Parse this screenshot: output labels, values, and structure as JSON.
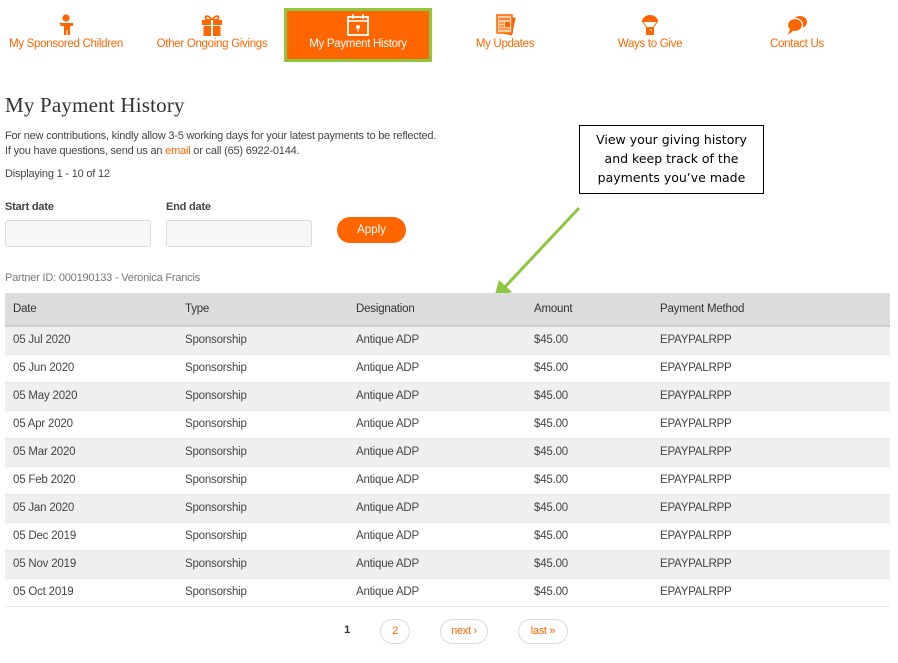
{
  "nav": {
    "items": [
      {
        "label": "My Sponsored Children",
        "icon": "child-icon",
        "active": false
      },
      {
        "label": "Other Ongoing Givings",
        "icon": "gift-icon",
        "active": false
      },
      {
        "label": "My Payment History",
        "icon": "calendar-icon",
        "active": true
      },
      {
        "label": "My Updates",
        "icon": "newspaper-icon",
        "active": false
      },
      {
        "label": "Ways to Give",
        "icon": "parachute-icon",
        "active": false
      },
      {
        "label": "Contact Us",
        "icon": "chat-bubbles-icon",
        "active": false
      }
    ]
  },
  "page": {
    "title": "My Payment History",
    "info_line1": "For new contributions, kindly allow 3-5 working days for your latest payments to be reflected.",
    "info_line2_prefix": "If you have questions, send us an ",
    "info_link": "email",
    "info_line2_suffix": " or call (65) 6922-0144.",
    "displaying": "Displaying 1 - 10 of 12"
  },
  "callout": {
    "text_line1": "View your giving history",
    "text_line2": "and keep track of the",
    "text_line3": "payments you’ve made",
    "arrow_color": "#8dc63f"
  },
  "filters": {
    "start_label": "Start date",
    "start_value": "",
    "end_label": "End date",
    "end_value": "",
    "apply_label": "Apply"
  },
  "partner": "Partner ID: 000190133 - Veronica Francis",
  "table": {
    "headers": [
      "Date",
      "Type",
      "Designation",
      "Amount",
      "Payment Method"
    ],
    "rows": [
      [
        "05 Jul 2020",
        "Sponsorship",
        "Antique ADP",
        "$45.00",
        "EPAYPALRPP"
      ],
      [
        "05 Jun 2020",
        "Sponsorship",
        "Antique ADP",
        "$45.00",
        "EPAYPALRPP"
      ],
      [
        "05 May 2020",
        "Sponsorship",
        "Antique ADP",
        "$45.00",
        "EPAYPALRPP"
      ],
      [
        "05 Apr 2020",
        "Sponsorship",
        "Antique ADP",
        "$45.00",
        "EPAYPALRPP"
      ],
      [
        "05 Mar 2020",
        "Sponsorship",
        "Antique ADP",
        "$45.00",
        "EPAYPALRPP"
      ],
      [
        "05 Feb 2020",
        "Sponsorship",
        "Antique ADP",
        "$45.00",
        "EPAYPALRPP"
      ],
      [
        "05 Jan 2020",
        "Sponsorship",
        "Antique ADP",
        "$45.00",
        "EPAYPALRPP"
      ],
      [
        "05 Dec 2019",
        "Sponsorship",
        "Antique ADP",
        "$45.00",
        "EPAYPALRPP"
      ],
      [
        "05 Nov 2019",
        "Sponsorship",
        "Antique ADP",
        "$45.00",
        "EPAYPALRPP"
      ],
      [
        "05 Oct 2019",
        "Sponsorship",
        "Antique ADP",
        "$45.00",
        "EPAYPALRPP"
      ]
    ]
  },
  "pagination": {
    "current": "1",
    "page2": "2",
    "next": "next ›",
    "last": "last »"
  },
  "colors": {
    "brand": "#ff6600",
    "highlight": "#8dc63f"
  }
}
